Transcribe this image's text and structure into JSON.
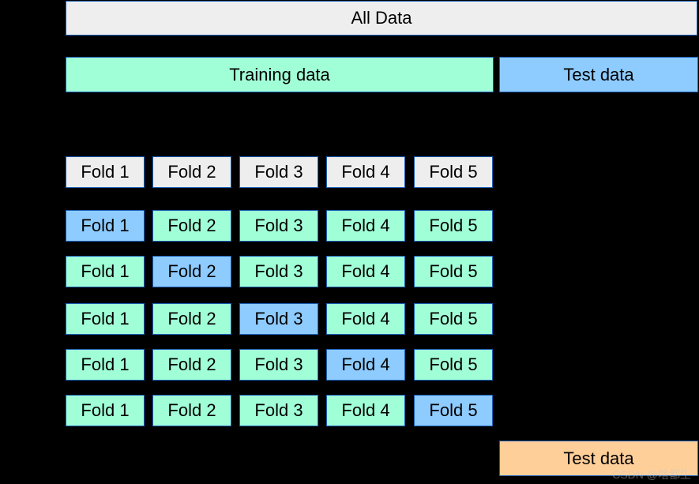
{
  "colors": {
    "grey": "#eeeeee",
    "mint": "#a1ffd7",
    "blue": "#8ecbff",
    "orange": "#fecf99",
    "border": "#1a5fb4",
    "background": "#000000"
  },
  "header": {
    "allData": "All Data",
    "trainingData": "Training data",
    "testData": "Test data"
  },
  "foldsHeader": [
    "Fold 1",
    "Fold 2",
    "Fold 3",
    "Fold 4",
    "Fold 5"
  ],
  "splits": [
    {
      "test": 0,
      "labels": [
        "Fold 1",
        "Fold 2",
        "Fold 3",
        "Fold 4",
        "Fold 5"
      ]
    },
    {
      "test": 1,
      "labels": [
        "Fold 1",
        "Fold 2",
        "Fold 3",
        "Fold 4",
        "Fold 5"
      ]
    },
    {
      "test": 2,
      "labels": [
        "Fold 1",
        "Fold 2",
        "Fold 3",
        "Fold 4",
        "Fold 5"
      ]
    },
    {
      "test": 3,
      "labels": [
        "Fold 1",
        "Fold 2",
        "Fold 3",
        "Fold 4",
        "Fold 5"
      ]
    },
    {
      "test": 4,
      "labels": [
        "Fold 1",
        "Fold 2",
        "Fold 3",
        "Fold 4",
        "Fold 5"
      ]
    }
  ],
  "final": {
    "testData": "Test data"
  },
  "watermark": "CSDN @啥都生"
}
